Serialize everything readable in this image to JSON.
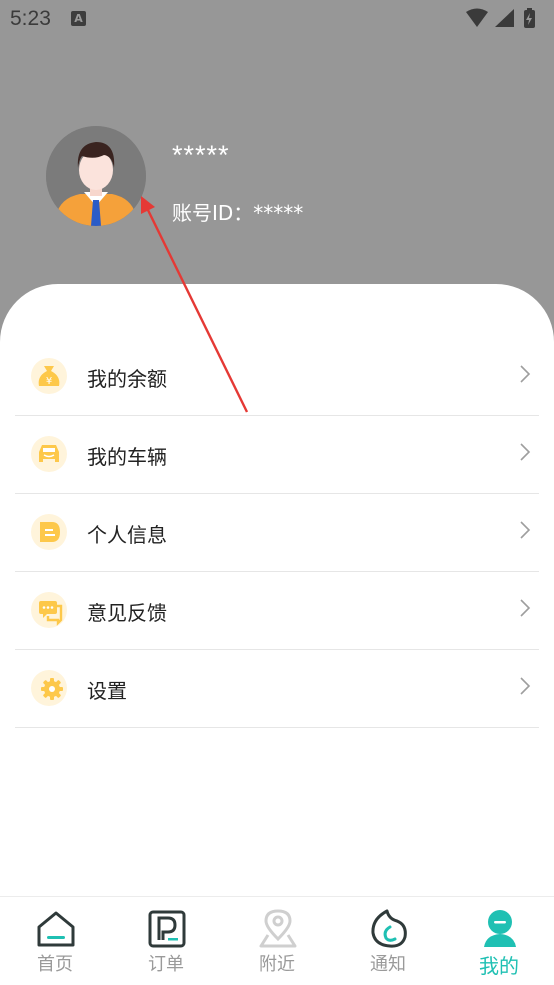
{
  "status_bar": {
    "time": "5:23",
    "notification_letter": "A"
  },
  "profile": {
    "username": "*****",
    "account_id": "账号ID：*****"
  },
  "menu": {
    "items": [
      {
        "label": "我的余额",
        "icon": "money-bag-icon"
      },
      {
        "label": "我的车辆",
        "icon": "car-icon"
      },
      {
        "label": "个人信息",
        "icon": "id-card-icon"
      },
      {
        "label": "意见反馈",
        "icon": "feedback-chat-icon"
      },
      {
        "label": "设置",
        "icon": "settings-gear-icon"
      }
    ]
  },
  "tabbar": {
    "tabs": [
      {
        "label": "首页",
        "icon": "home-icon",
        "active": false
      },
      {
        "label": "订单",
        "icon": "order-parking-icon",
        "active": false
      },
      {
        "label": "附近",
        "icon": "map-pin-icon",
        "active": false
      },
      {
        "label": "通知",
        "icon": "notification-moon-icon",
        "active": false
      },
      {
        "label": "我的",
        "icon": "profile-person-icon",
        "active": true
      }
    ]
  },
  "colors": {
    "header": "#979797",
    "accent": "#1fc0b3",
    "icon_yellow": "#fdc84a"
  }
}
